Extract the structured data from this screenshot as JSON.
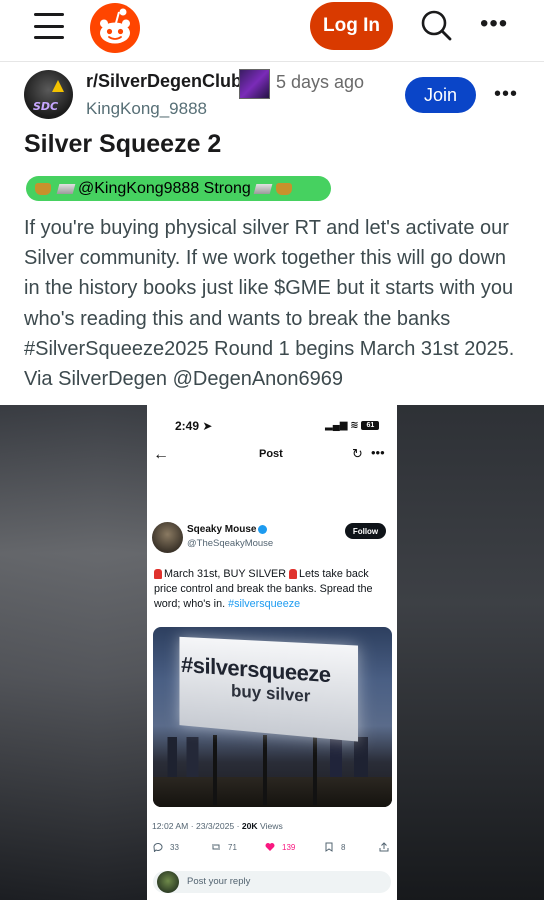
{
  "topbar": {
    "menu_icon": "hamburger-menu-icon",
    "logo_icon": "reddit-snoo-logo-icon",
    "login_label": "Log In",
    "search_icon": "search-icon",
    "more_icon": "more-horizontal-icon",
    "more_label": "•••"
  },
  "post": {
    "subreddit": "r/SilverDegenClub",
    "time_ago": "5 days ago",
    "author": "KingKong_9888",
    "join_label": "Join",
    "more_label": "•••",
    "title": "Silver Squeeze 2",
    "user_flair": "@KingKong9888 Strong",
    "body": "If you're buying physical silver RT and let's activate our Silver community. If we work together this will go down in the history books just like $GME but it starts with you who's reading this and wants to break the banks #SilverSqueeze2025 Round 1 begins March 31st 2025. Via SilverDegen @DegenAnon6969",
    "accent_color": "#d93a00",
    "join_color": "#0a45c8",
    "flair_color": "#46d160"
  },
  "screenshot": {
    "status_time": "2:49",
    "battery": "61",
    "header_title": "Post",
    "author_name": "Sqeaky Mouse",
    "author_handle": "@TheSqeakyMouse",
    "follow_label": "Follow",
    "tweet_text_1": "March 31st, BUY SILVER",
    "tweet_text_2": "Lets take back price control and break the banks. Spread the word; who's in.",
    "tweet_hashtag": "#silversqueeze",
    "billboard_line1": "#silversqueeze",
    "billboard_line2": "buy silver",
    "meta_datetime": "12:02 AM · 23/3/2025 ·",
    "meta_views_count": "20K",
    "meta_views_label": "Views",
    "replies": "33",
    "reposts": "71",
    "likes": "139",
    "bookmarks": "8",
    "reply_placeholder": "Post your reply"
  }
}
